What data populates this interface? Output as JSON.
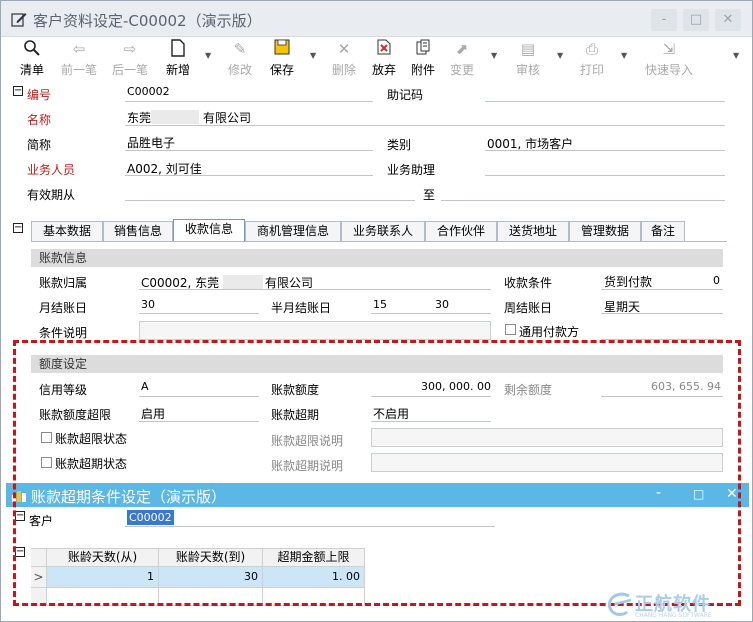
{
  "window": {
    "title": "客户资料设定-C00002（演示版）",
    "controls": [
      "-",
      "□",
      "✕"
    ]
  },
  "toolbar": [
    {
      "label": "清单",
      "enabled": true
    },
    {
      "label": "前一笔",
      "enabled": false
    },
    {
      "label": "后一笔",
      "enabled": false
    },
    {
      "label": "新增",
      "enabled": true
    },
    {
      "label": "修改",
      "enabled": false
    },
    {
      "label": "保存",
      "enabled": true
    },
    {
      "label": "删除",
      "enabled": false
    },
    {
      "label": "放弃",
      "enabled": true
    },
    {
      "label": "附件",
      "enabled": true
    },
    {
      "label": "变更",
      "enabled": false
    },
    {
      "label": "审核",
      "enabled": false
    },
    {
      "label": "打印",
      "enabled": false
    },
    {
      "label": "快速导入",
      "enabled": false
    }
  ],
  "header": {
    "code_label": "编号",
    "code_value": "C00002",
    "mnemonic_label": "助记码",
    "name_label": "名称",
    "name_prefix": "东莞",
    "name_suffix": "有限公司",
    "short_label": "简称",
    "short_value": "品胜电子",
    "category_label": "类别",
    "category_value": "0001, 市场客户",
    "sales_label": "业务人员",
    "sales_value": "A002, 刘可佳",
    "assist_label": "业务助理",
    "valid_label": "有效期从",
    "to_label": "至"
  },
  "tabs": [
    "基本数据",
    "销售信息",
    "收款信息",
    "商机管理信息",
    "业务联系人",
    "合作伙伴",
    "送货地址",
    "管理数据",
    "备注"
  ],
  "active_tab": "收款信息",
  "payment": {
    "section": "账款信息",
    "owner_label": "账款归属",
    "owner_prefix": "C00002, 东莞",
    "owner_suffix": "有限公司",
    "terms_label": "收款条件",
    "terms_value": "货到付款",
    "terms_num": "0",
    "monthly_label": "月结账日",
    "monthly_value": "30",
    "half_label": "半月结账日",
    "half_v1": "15",
    "half_v2": "30",
    "weekly_label": "周结账日",
    "weekly_value": "星期天",
    "cond_label": "条件说明",
    "general_payer": "通用付款方"
  },
  "credit": {
    "section": "额度设定",
    "level_label": "信用等级",
    "level_value": "A",
    "amount_label": "账款额度",
    "amount_value": "300, 000. 00",
    "remain_label": "剩余额度",
    "remain_value": "603, 655. 94",
    "over_label": "账款额度超限",
    "over_value": "启用",
    "overdue_label": "账款超期",
    "overdue_value": "不启用",
    "over_state": "账款超限状态",
    "over_desc": "账款超限说明",
    "overdue_state": "账款超期状态",
    "overdue_desc": "账款超期说明"
  },
  "dialog": {
    "title": "账款超期条件设定（演示版）",
    "controls": [
      "-",
      "□",
      "✕"
    ],
    "customer_label": "客户",
    "customer_value": "C00002",
    "columns": [
      "账龄天数(从)",
      "账龄天数(到)",
      "超期金额上限"
    ],
    "rows": [
      {
        "from": "1",
        "to": "30",
        "limit": "1. 00"
      }
    ],
    "row_marker": ">"
  },
  "watermark": {
    "text": "正航软件",
    "sub": "CHANG HANG SOFTWARE"
  },
  "colors": {
    "dialog_title": "#5bb7e6",
    "required_label": "#b22222",
    "dashed_frame": "#c0181c",
    "selection": "#3a78d0",
    "row_highlight": "#cde6f7"
  }
}
